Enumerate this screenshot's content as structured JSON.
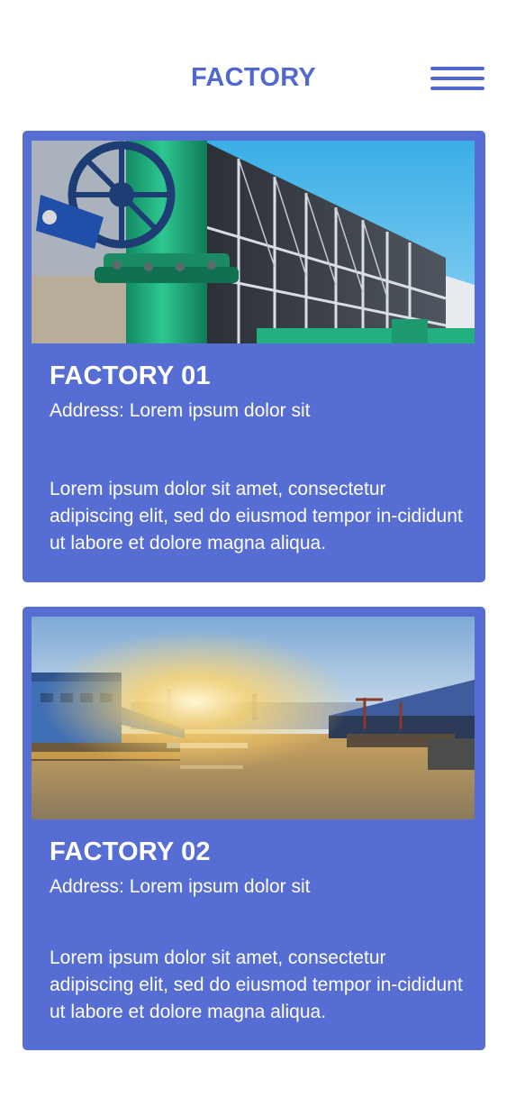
{
  "header": {
    "title": "FACTORY",
    "menu_icon": "hamburger-menu-icon"
  },
  "colors": {
    "accent": "#5068cf",
    "card_background": "#566dd3",
    "card_text": "#ffffff"
  },
  "factories": [
    {
      "title": "FACTORY 01",
      "address": "Address: Lorem ipsum dolor sit",
      "description": "Lorem ipsum dolor sit amet, consectetur adipiscing elit, sed do eiusmod tempor in-cididunt ut labore et dolore magna aliqua.",
      "image": "industrial-cooling-tower-green-pipes-photo"
    },
    {
      "title": "FACTORY 02",
      "address": "Address: Lorem ipsum dolor sit",
      "description": "Lorem ipsum dolor sit amet, consectetur adipiscing elit, sed do eiusmod tempor in-cididunt ut labore et dolore magna aliqua.",
      "image": "industrial-harbor-sunset-river-photo"
    }
  ]
}
